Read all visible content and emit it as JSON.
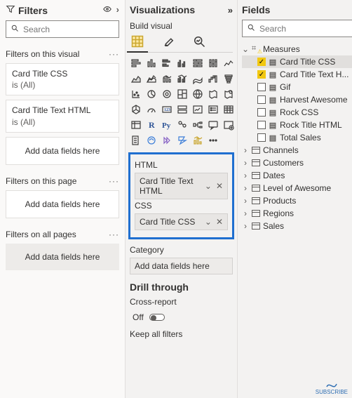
{
  "filters": {
    "title": "Filters",
    "search_placeholder": "Search",
    "sections": {
      "visual": {
        "label": "Filters on this visual",
        "cards": [
          {
            "field": "Card Title CSS",
            "summary": "is (All)"
          },
          {
            "field": "Card Title Text HTML",
            "summary": "is (All)"
          }
        ],
        "add_label": "Add data fields here"
      },
      "page": {
        "label": "Filters on this page",
        "add_label": "Add data fields here"
      },
      "all": {
        "label": "Filters on all pages",
        "add_label": "Add data fields here"
      }
    }
  },
  "viz": {
    "title": "Visualizations",
    "subtitle": "Build visual",
    "wells": {
      "group": [
        {
          "label": "HTML",
          "value": "Card Title Text HTML"
        },
        {
          "label": "CSS",
          "value": "Card Title CSS"
        }
      ],
      "rest": [
        {
          "label": "Category",
          "value": "Add data fields here",
          "placeholder": true
        }
      ]
    },
    "drill": {
      "title": "Drill through",
      "cross_label": "Cross-report",
      "toggle": "Off",
      "keep_label": "Keep all filters"
    }
  },
  "fields": {
    "title": "Fields",
    "search_placeholder": "Search",
    "tree": {
      "measures_label": "Measures",
      "measures": [
        {
          "label": "Card Title CSS",
          "checked": true,
          "selected": true
        },
        {
          "label": "Card Title Text H...",
          "checked": true,
          "selected": false
        },
        {
          "label": "Gif",
          "checked": false,
          "selected": false
        },
        {
          "label": "Harvest Awesome",
          "checked": false,
          "selected": false
        },
        {
          "label": "Rock CSS",
          "checked": false,
          "selected": false
        },
        {
          "label": "Rock Title HTML",
          "checked": false,
          "selected": false
        },
        {
          "label": "Total Sales",
          "checked": false,
          "selected": false
        }
      ],
      "tables": [
        "Channels",
        "Customers",
        "Dates",
        "Level of Awesome",
        "Products",
        "Regions",
        "Sales"
      ]
    }
  },
  "subscribe": "SUBSCRIBE"
}
